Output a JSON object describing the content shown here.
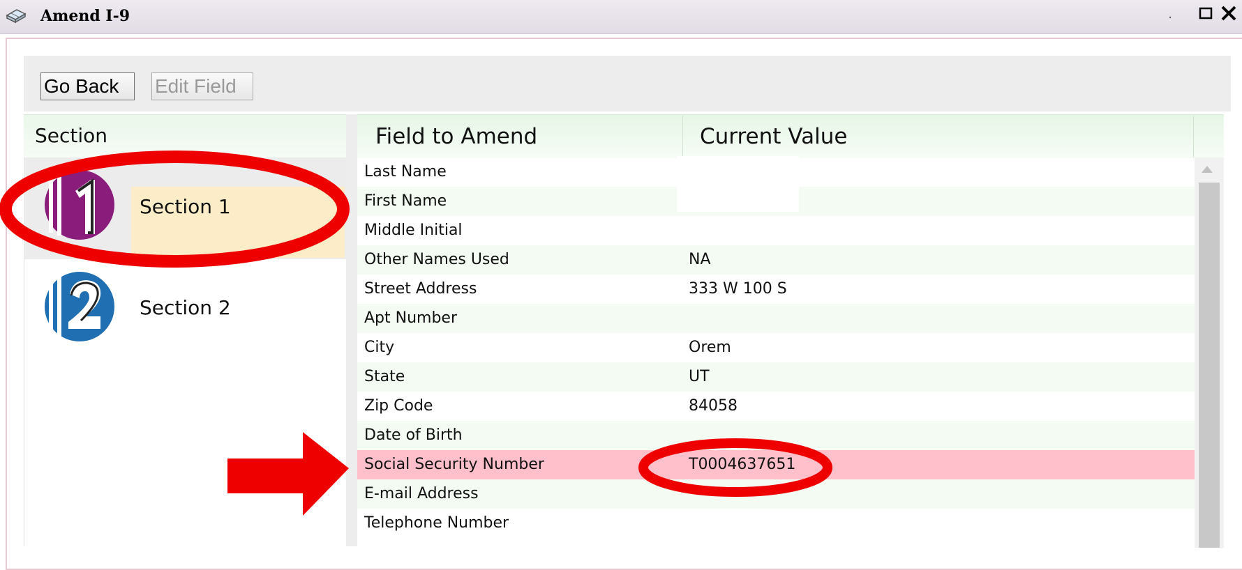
{
  "window": {
    "title": "Amend I-9",
    "dot": ".",
    "icon": "form-icon"
  },
  "toolbar": {
    "go_back_label": "Go Back",
    "edit_field_label": "Edit Field"
  },
  "sections_panel": {
    "header": "Section",
    "items": [
      {
        "label": "Section 1",
        "icon": "section-1-icon",
        "selected": true
      },
      {
        "label": "Section 2",
        "icon": "section-2-icon",
        "selected": false
      }
    ]
  },
  "table": {
    "headers": [
      "Field to Amend",
      "Current Value"
    ],
    "rows": [
      {
        "field": "Last Name",
        "value": ""
      },
      {
        "field": "First Name",
        "value": ""
      },
      {
        "field": "Middle Initial",
        "value": ""
      },
      {
        "field": "Other Names Used",
        "value": "NA"
      },
      {
        "field": "Street Address",
        "value": "333 W 100 S"
      },
      {
        "field": "Apt Number",
        "value": ""
      },
      {
        "field": "City",
        "value": "Orem"
      },
      {
        "field": "State",
        "value": "UT"
      },
      {
        "field": "Zip Code",
        "value": "84058"
      },
      {
        "field": "Date of Birth",
        "value": ""
      },
      {
        "field": "Social Security Number",
        "value": "T0004637651"
      },
      {
        "field": "E-mail Address",
        "value": ""
      },
      {
        "field": "Telephone Number",
        "value": ""
      }
    ],
    "highlighted_row_index": 10
  },
  "colors": {
    "highlight_row": "#ffc0cb",
    "selected_section": "#fcecc8",
    "annotation_red": "#ee0000",
    "section1_purple": "#8a1c7c",
    "section2_blue": "#1f6fb2"
  }
}
